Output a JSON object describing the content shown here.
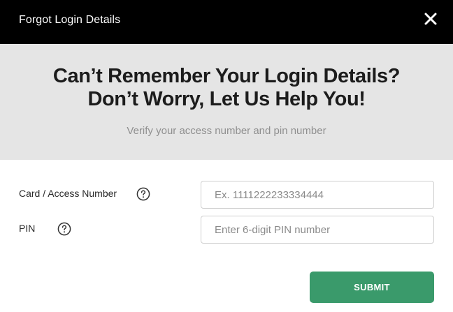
{
  "dialog": {
    "title": "Forgot Login Details",
    "close_icon": "close-icon"
  },
  "hero": {
    "heading_line1": "Can’t Remember Your Login Details?",
    "heading_line2": "Don’t Worry, Let Us Help You!",
    "subtitle": "Verify your access number and pin number"
  },
  "form": {
    "card_label": "Card / Access Number",
    "card_placeholder": "Ex. 1111222233334444",
    "card_value": "",
    "pin_label": "PIN",
    "pin_placeholder": "Enter 6-digit PIN number",
    "pin_value": "",
    "help_icon": "question-circle-icon",
    "submit_label": "SUBMIT"
  },
  "colors": {
    "titlebar": "#000000",
    "hero_bg": "#e5e5e5",
    "accent": "#3a9a6b"
  }
}
